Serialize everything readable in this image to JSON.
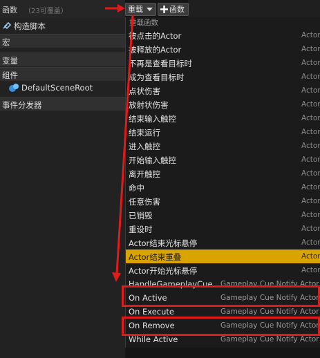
{
  "panel": {
    "title": "函数",
    "count": "（23可覆盖）",
    "items": [
      "构造脚本",
      "宏",
      "变量",
      "组件",
      "DefaultSceneRoot",
      "事件分发器"
    ]
  },
  "toolbar": {
    "override_label": "重载",
    "add_function_label": "函数"
  },
  "menu": {
    "header": "重载函数",
    "items": [
      {
        "name": "被点击的Actor",
        "category": "Actor"
      },
      {
        "name": "被释放的Actor",
        "category": "Actor"
      },
      {
        "name": "不再是查看目标时",
        "category": "Actor"
      },
      {
        "name": "成为查看目标时",
        "category": "Actor"
      },
      {
        "name": "点状伤害",
        "category": "Actor"
      },
      {
        "name": "放射状伤害",
        "category": "Actor"
      },
      {
        "name": "结束输入触控",
        "category": "Actor"
      },
      {
        "name": "结束运行",
        "category": "Actor"
      },
      {
        "name": "进入触控",
        "category": "Actor"
      },
      {
        "name": "开始输入触控",
        "category": "Actor"
      },
      {
        "name": "离开触控",
        "category": "Actor"
      },
      {
        "name": "命中",
        "category": "Actor"
      },
      {
        "name": "任意伤害",
        "category": "Actor"
      },
      {
        "name": "已销毁",
        "category": "Actor"
      },
      {
        "name": "重设时",
        "category": "Actor"
      },
      {
        "name": "Actor结束光标悬停",
        "category": "Actor"
      },
      {
        "name": "Actor结束重叠",
        "category": "Actor"
      },
      {
        "name": "Actor开始光标悬停",
        "category": "Actor"
      }
    ],
    "gameplay_items": [
      {
        "name": "HandleGameplayCue",
        "category": "Gameplay Cue Notify Actor"
      },
      {
        "name": "On Active",
        "category": "Gameplay Cue Notify Actor"
      },
      {
        "name": "On Execute",
        "category": "Gameplay Cue Notify Actor"
      },
      {
        "name": "On Remove",
        "category": "Gameplay Cue Notify Actor"
      },
      {
        "name": "While Active",
        "category": "Gameplay Cue Notify Actor"
      }
    ]
  },
  "colors": {
    "highlight": "#d9a300",
    "annotation": "#e01b1b"
  }
}
